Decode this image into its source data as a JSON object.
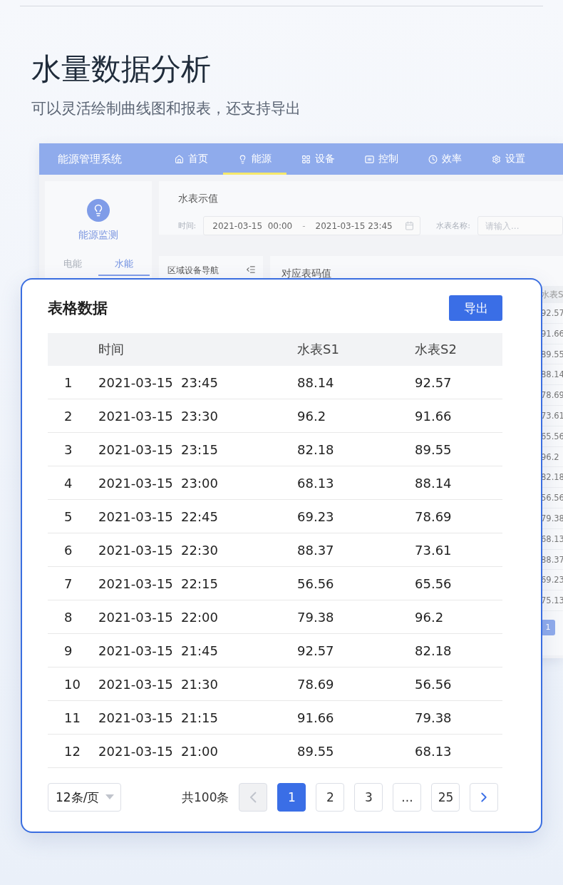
{
  "heading": "水量数据分析",
  "subtitle": "可以灵活绘制曲线图和报表，还支持导出",
  "app": {
    "title": "能源管理系统",
    "nav": [
      {
        "label": "首页",
        "selected": false
      },
      {
        "label": "能源",
        "selected": true
      },
      {
        "label": "设备",
        "selected": false
      },
      {
        "label": "控制",
        "selected": false
      },
      {
        "label": "效率",
        "selected": false
      },
      {
        "label": "设置",
        "selected": false
      }
    ]
  },
  "sidebar": {
    "title": "能源监测",
    "tabs": [
      {
        "label": "电能",
        "selected": false
      },
      {
        "label": "水能",
        "selected": true
      }
    ]
  },
  "filter": {
    "title": "水表示值",
    "time_label": "时间:",
    "start": "2021-03-15  00:00",
    "separator": "-",
    "end": "2021-03-15 23:45",
    "name_label": "水表名称:",
    "name_placeholder": "请输入..."
  },
  "nav_panel": {
    "title": "区域设备导航"
  },
  "chart_panel": {
    "title": "对应表码值",
    "column_header": "水表S",
    "values": [
      "92.57",
      "91.66",
      "89.55",
      "88.14",
      "78.69",
      "73.61",
      "65.56",
      "96.2",
      "82.18",
      "56.56",
      "79.38",
      "68.13",
      "88.37",
      "69.23",
      "75.13"
    ],
    "page": {
      "label": "1",
      "selected": true
    }
  },
  "card": {
    "title": "表格数据",
    "export": "导出",
    "columns": [
      "时间",
      "水表S1",
      "水表S2"
    ],
    "rows": [
      {
        "index": "1",
        "time": "2021-03-15  23:45",
        "s1": "88.14",
        "s2": "92.57"
      },
      {
        "index": "2",
        "time": "2021-03-15  23:30",
        "s1": "96.2",
        "s2": "91.66"
      },
      {
        "index": "3",
        "time": "2021-03-15  23:15",
        "s1": "82.18",
        "s2": "89.55"
      },
      {
        "index": "4",
        "time": "2021-03-15  23:00",
        "s1": "68.13",
        "s2": "88.14"
      },
      {
        "index": "5",
        "time": "2021-03-15  22:45",
        "s1": "69.23",
        "s2": "78.69"
      },
      {
        "index": "6",
        "time": "2021-03-15  22:30",
        "s1": "88.37",
        "s2": "73.61"
      },
      {
        "index": "7",
        "time": "2021-03-15  22:15",
        "s1": "56.56",
        "s2": "65.56"
      },
      {
        "index": "8",
        "time": "2021-03-15  22:00",
        "s1": "79.38",
        "s2": "96.2"
      },
      {
        "index": "9",
        "time": "2021-03-15  21:45",
        "s1": "92.57",
        "s2": "82.18"
      },
      {
        "index": "10",
        "time": "2021-03-15  21:30",
        "s1": "78.69",
        "s2": "56.56"
      },
      {
        "index": "11",
        "time": "2021-03-15  21:15",
        "s1": "91.66",
        "s2": "79.38"
      },
      {
        "index": "12",
        "time": "2021-03-15  21:00",
        "s1": "89.55",
        "s2": "68.13"
      }
    ],
    "pagination": {
      "page_size": "12条/页",
      "total": "共100条",
      "prev_disabled": true,
      "pages": [
        {
          "label": "1",
          "selected": true
        },
        {
          "label": "2",
          "selected": false
        },
        {
          "label": "3",
          "selected": false
        },
        {
          "label": "...",
          "selected": false
        },
        {
          "label": "25",
          "selected": false
        }
      ]
    }
  }
}
